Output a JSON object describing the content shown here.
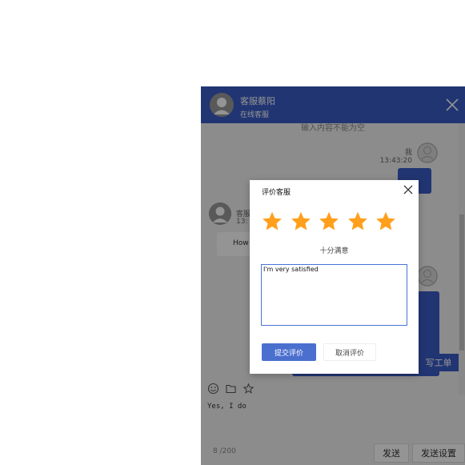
{
  "colors": {
    "header": "#3a5cc6",
    "primary_button": "#4a6fce",
    "star": "#ff9f1c",
    "input_border": "#4a74d8"
  },
  "chat": {
    "agent_name": "客服蔡阳",
    "agent_status": "在线客服",
    "notice": "输入内容不能为空",
    "me_name": "我",
    "me_time": "13:43:20",
    "agent_label": "客服",
    "agent_time": "13:",
    "agent_message": "How",
    "ticket_button": "写工单",
    "composer_text": "Yes, I do",
    "char_count": "8 /200",
    "send_button": "发送",
    "send_settings_button": "发送设置",
    "icons": [
      "emoji-icon",
      "folder-icon",
      "star-icon"
    ]
  },
  "modal": {
    "title": "评价客服",
    "rating": 5,
    "max_rating": 5,
    "rating_text": "十分满意",
    "comment": "I'm very satisfied",
    "submit_label": "提交评价",
    "cancel_label": "取消评价"
  }
}
